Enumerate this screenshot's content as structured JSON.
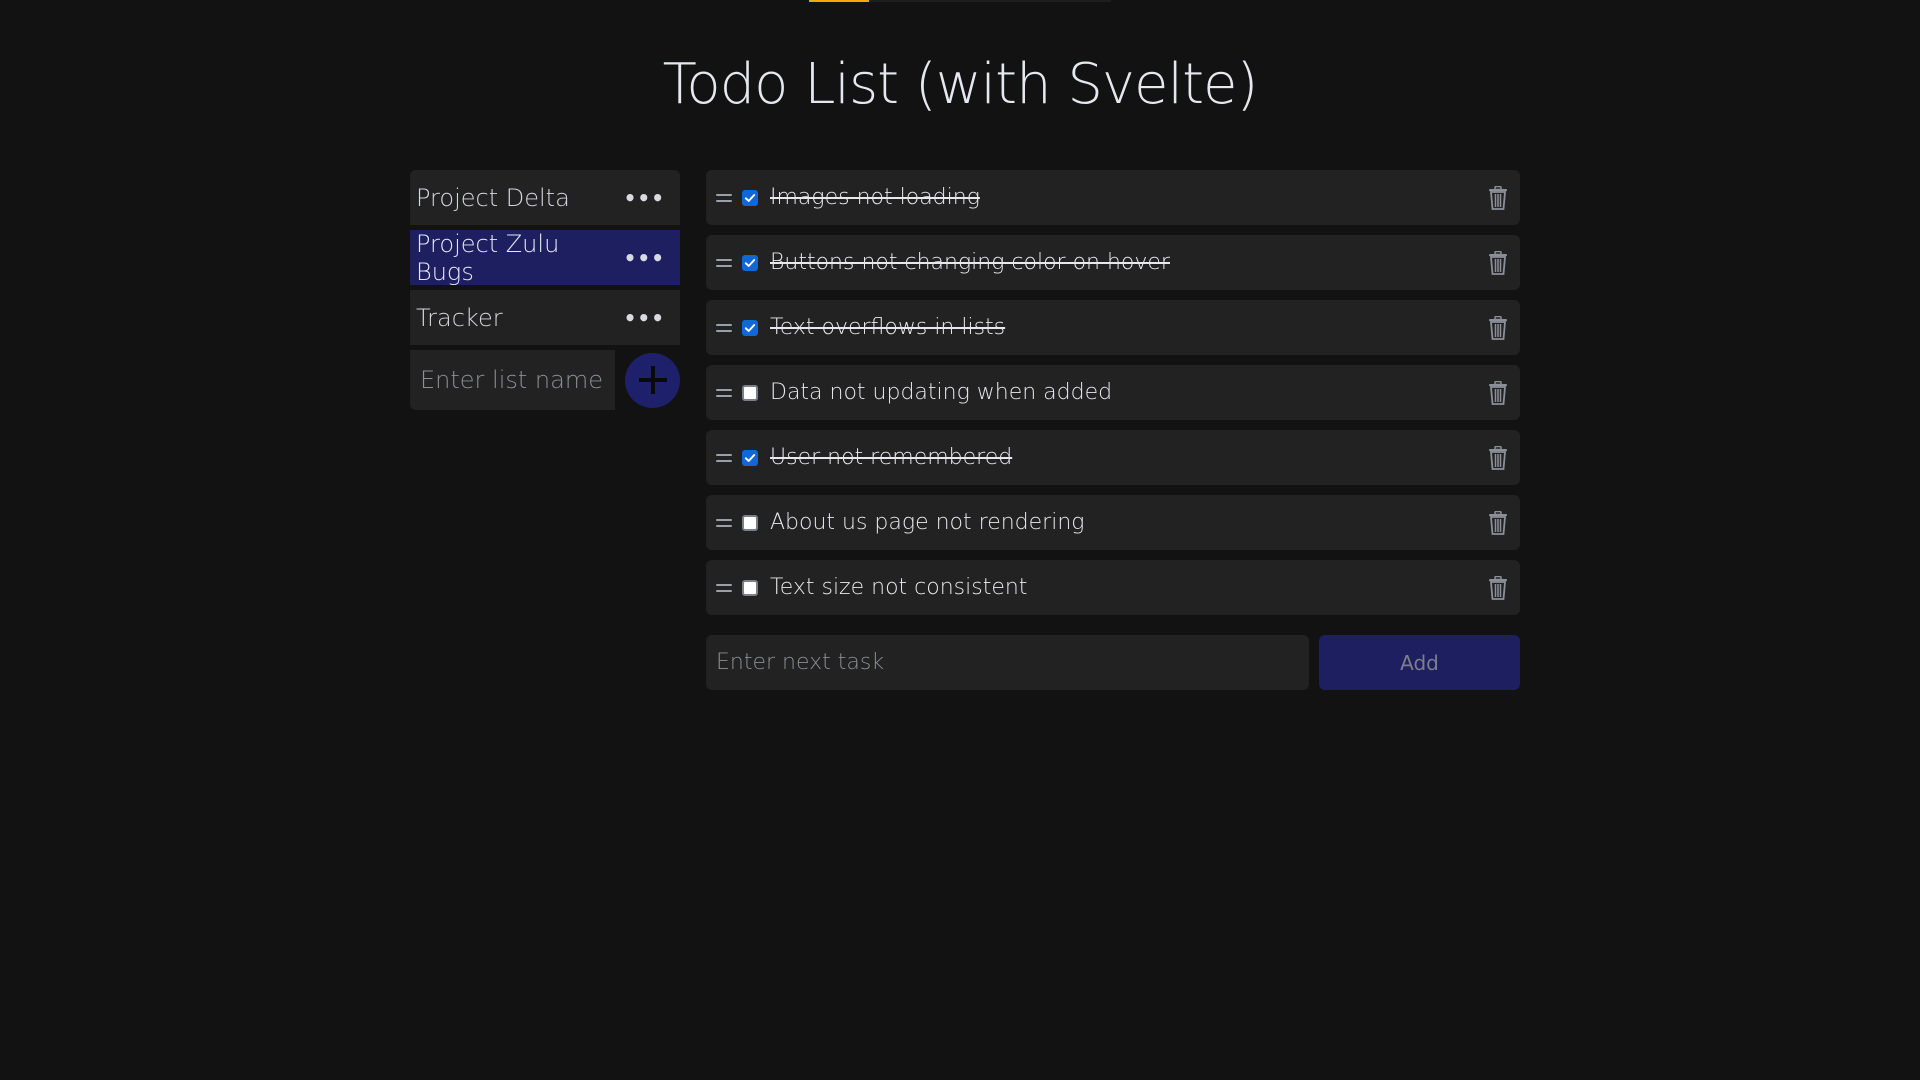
{
  "progress": {
    "percent": 20,
    "fill_color": "#f5a70a"
  },
  "header": {
    "title": "Todo List (with Svelte)"
  },
  "sidebar": {
    "lists": [
      {
        "label": "Project Delta",
        "active": false,
        "menu_icon": "more-horizontal-icon"
      },
      {
        "label": "Project Zulu Bugs",
        "active": true,
        "menu_icon": "more-horizontal-icon"
      },
      {
        "label": "Tracker",
        "active": false,
        "menu_icon": "more-horizontal-icon"
      }
    ],
    "new_list": {
      "placeholder": "Enter list name",
      "value": "",
      "button_icon": "plus-icon"
    },
    "menu_glyph": "•••"
  },
  "tasks": {
    "items": [
      {
        "text": "Images not loading",
        "done": true
      },
      {
        "text": "Buttons not changing color on hover",
        "done": true
      },
      {
        "text": "Text overflows in lists",
        "done": true
      },
      {
        "text": "Data not updating when added",
        "done": false
      },
      {
        "text": "User not remembered",
        "done": true
      },
      {
        "text": "About us page not rendering",
        "done": false
      },
      {
        "text": "Text size not consistent",
        "done": false
      }
    ],
    "new_task": {
      "placeholder": "Enter next task",
      "value": ""
    },
    "add_label": "Add"
  },
  "colors": {
    "background": "#121212",
    "panel": "#222222",
    "accent": "#1e1f60",
    "checkbox_checked": "#0f67d8"
  }
}
